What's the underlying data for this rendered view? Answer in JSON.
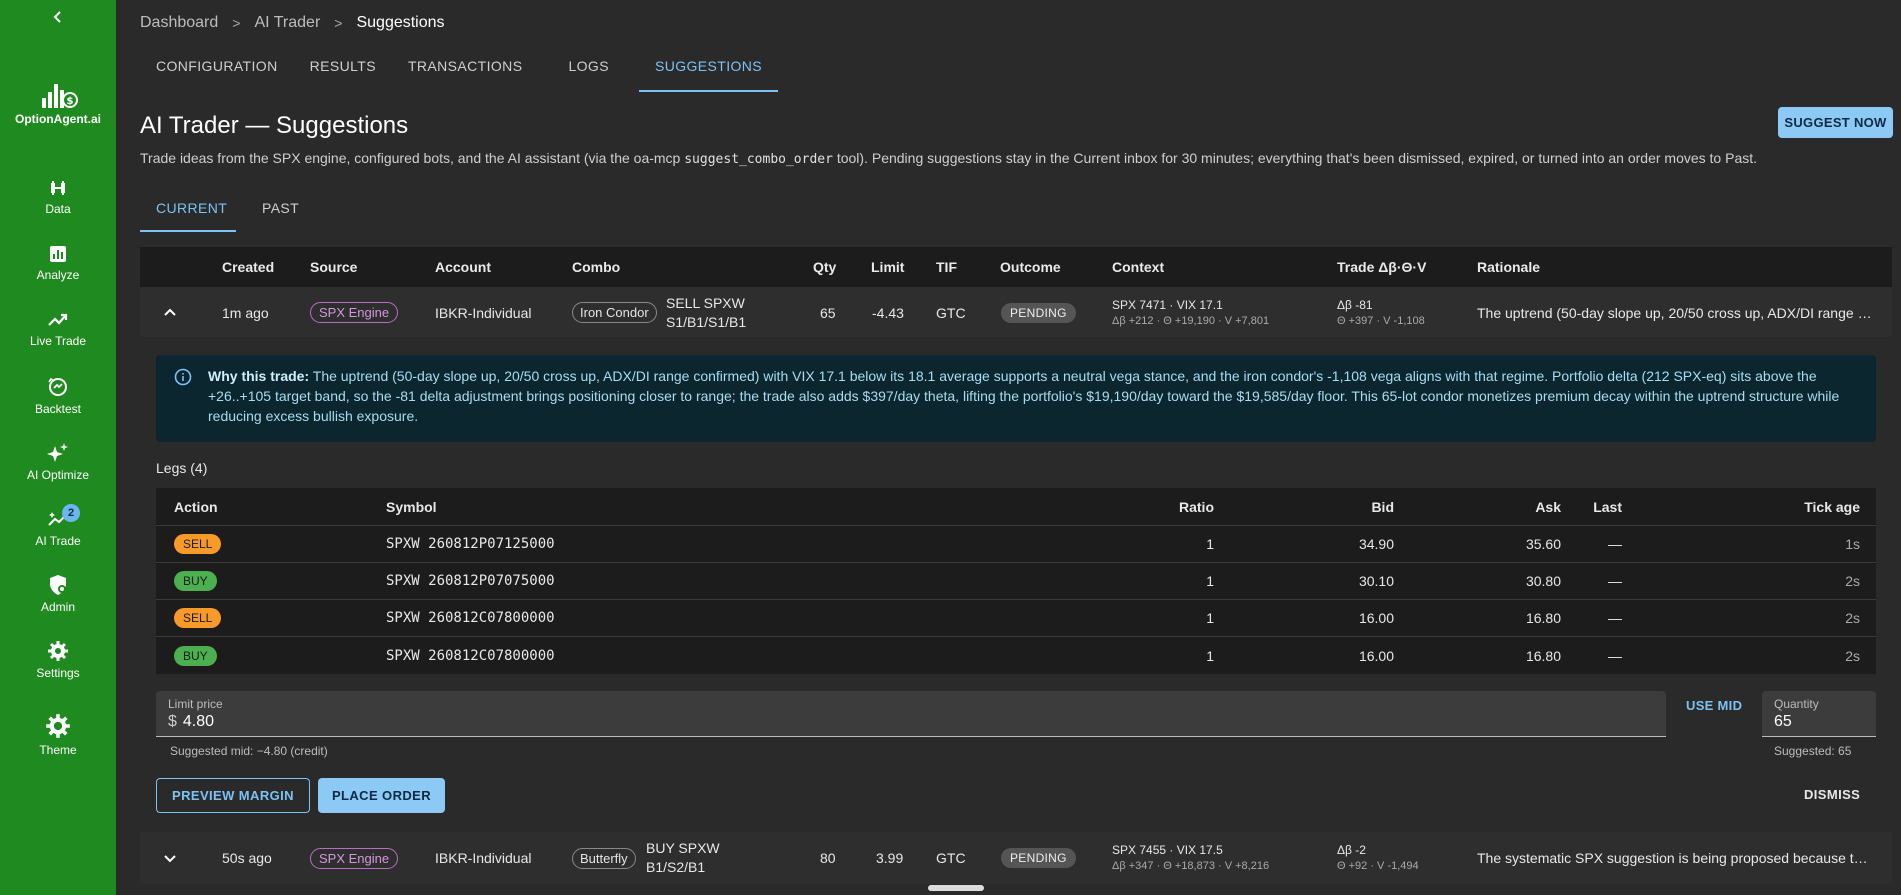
{
  "sidebar": {
    "brand": "OptionAgent.ai",
    "items": [
      {
        "label": "Data",
        "icon": "data-icon"
      },
      {
        "label": "Analyze",
        "icon": "analyze-icon"
      },
      {
        "label": "Live Trade",
        "icon": "live-trade-icon"
      },
      {
        "label": "Backtest",
        "icon": "backtest-icon"
      },
      {
        "label": "AI Optimize",
        "icon": "sparkle-icon"
      },
      {
        "label": "AI Trade",
        "icon": "ai-trade-icon",
        "badge": "2"
      },
      {
        "label": "Admin",
        "icon": "shield-icon"
      },
      {
        "label": "Settings",
        "icon": "gear-icon"
      },
      {
        "label": "Theme",
        "icon": "theme-gear-icon"
      }
    ]
  },
  "breadcrumb": {
    "items": [
      "Dashboard",
      "AI Trader",
      "Suggestions"
    ]
  },
  "tabs": [
    "CONFIGURATION",
    "RESULTS",
    "TRANSACTIONS",
    "LOGS",
    "SUGGESTIONS"
  ],
  "active_tab": "SUGGESTIONS",
  "page": {
    "title": "AI Trader — Suggestions",
    "suggest_button": "SUGGEST NOW",
    "description_pre": "Trade ideas from the SPX engine, configured bots, and the AI assistant (via the oa-mcp ",
    "description_code": "suggest_combo_order",
    "description_post": " tool). Pending suggestions stay in the Current inbox for 30 minutes; everything that's been dismissed, expired, or turned into an order moves to Past."
  },
  "subtabs": [
    "CURRENT",
    "PAST"
  ],
  "table": {
    "headers": [
      "Created",
      "Source",
      "Account",
      "Combo",
      "Qty",
      "Limit",
      "TIF",
      "Outcome",
      "Context",
      "Trade Δβ·Θ·V",
      "Rationale"
    ],
    "rows": [
      {
        "created": "1m ago",
        "source": "SPX Engine",
        "account": "IBKR-Individual",
        "combo_type": "Iron Condor",
        "combo_line1": "SELL SPXW",
        "combo_line2": "S1/B1/S1/B1",
        "qty": "65",
        "limit": "-4.43",
        "tif": "GTC",
        "outcome": "PENDING",
        "context_line1": "SPX 7471 · VIX 17.1",
        "context_line2": "Δβ +212 · Θ +19,190 · V +7,801",
        "greeks_line1": "Δβ -81",
        "greeks_line2": "Θ +397 · V -1,108",
        "rationale": "The uptrend (50-day slope up, 20/50 cross up, ADX/DI range confirmed) with VIX 17.1 below its 18.1 average"
      },
      {
        "created": "50s ago",
        "source": "SPX Engine",
        "account": "IBKR-Individual",
        "combo_type": "Butterfly",
        "combo_line1": "BUY SPXW",
        "combo_line2": "B1/S2/B1",
        "qty": "80",
        "limit": "3.99",
        "tif": "GTC",
        "outcome": "PENDING",
        "context_line1": "SPX 7455 · VIX 17.5",
        "context_line2": "Δβ +347 · Θ +18,873 · V +8,216",
        "greeks_line1": "Δβ -2",
        "greeks_line2": "Θ +92 · V -1,494",
        "rationale": "The systematic SPX suggestion is being proposed because the market regime"
      }
    ]
  },
  "expanded": {
    "why_label": "Why this trade:",
    "why_text": " The uptrend (50-day slope up, 20/50 cross up, ADX/DI range confirmed) with VIX 17.1 below its 18.1 average supports a neutral vega stance, and the iron condor's -1,108 vega aligns with that regime. Portfolio delta (212 SPX-eq) sits above the +26..+105 target band, so the -81 delta adjustment brings positioning closer to range; the trade also adds $397/day theta, lifting the portfolio's $19,190/day toward the $19,585/day floor. This 65-lot condor monetizes premium decay within the uptrend structure while reducing excess bullish exposure.",
    "legs_title": "Legs (4)",
    "legs_headers": [
      "Action",
      "Symbol",
      "Ratio",
      "Bid",
      "Ask",
      "Last",
      "Tick age"
    ],
    "legs": [
      {
        "action": "SELL",
        "symbol": "SPXW 260812P07125000",
        "ratio": "1",
        "bid": "34.90",
        "ask": "35.60",
        "last": "—",
        "tick": "1s"
      },
      {
        "action": "BUY",
        "symbol": "SPXW 260812P07075000",
        "ratio": "1",
        "bid": "30.10",
        "ask": "30.80",
        "last": "—",
        "tick": "2s"
      },
      {
        "action": "SELL",
        "symbol": "SPXW 260812C07800000",
        "ratio": "1",
        "bid": "16.00",
        "ask": "16.80",
        "last": "—",
        "tick": "2s"
      },
      {
        "action": "BUY",
        "symbol": "SPXW 260812C07800000",
        "ratio": "1",
        "bid": "16.00",
        "ask": "16.80",
        "last": "—",
        "tick": "2s"
      }
    ],
    "limit_label": "Limit price",
    "limit_prefix": "$",
    "limit_value": "4.80",
    "limit_helper": "Suggested mid: −4.80 (credit)",
    "use_mid": "USE MID",
    "qty_label": "Quantity",
    "qty_value": "65",
    "qty_helper": "Suggested: 65",
    "preview_margin": "PREVIEW MARGIN",
    "place_order": "PLACE ORDER",
    "dismiss": "DISMISS"
  },
  "colors": {
    "sidebar": "#1f8a1f",
    "accent": "#7cc2f5",
    "sell": "#f79a2a",
    "buy": "#4caf50",
    "source_chip": "#b66fc3"
  }
}
